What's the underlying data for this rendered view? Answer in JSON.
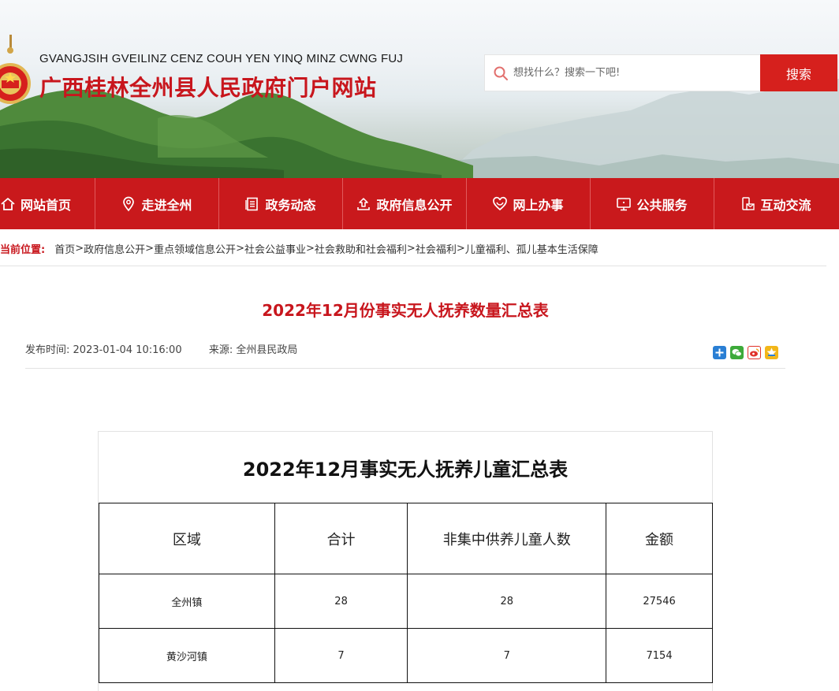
{
  "header": {
    "site_name_en": "GVANGJSIH GVEILINZ CENZ COUH YEN YINQ MINZ CWNG FUJ",
    "site_name_cn": "广西桂林全州县人民政府门户网站"
  },
  "search": {
    "placeholder": "想找什么？搜索一下吧!",
    "button_label": "搜索"
  },
  "nav": {
    "items": [
      {
        "label": "网站首页",
        "icon": "home-icon"
      },
      {
        "label": "走进全州",
        "icon": "location-pin-icon"
      },
      {
        "label": "政务动态",
        "icon": "document-icon"
      },
      {
        "label": "政府信息公开",
        "icon": "upload-icon"
      },
      {
        "label": "网上办事",
        "icon": "heart-icon"
      },
      {
        "label": "公共服务",
        "icon": "monitor-icon"
      },
      {
        "label": "互动交流",
        "icon": "mobile-mail-icon"
      }
    ]
  },
  "breadcrumb": {
    "label": "当前位置:",
    "items": [
      "首页",
      "政府信息公开",
      "重点领域信息公开",
      "社会公益事业",
      "社会救助和社会福利",
      "社会福利",
      "儿童福利、孤儿基本生活保障"
    ],
    "separator": ">"
  },
  "article": {
    "title": "2022年12月份事实无人抚养数量汇总表",
    "publish_label": "发布时间:",
    "publish_time": "2023-01-04 10:16:00",
    "source_label": "来源:",
    "source": "全州县民政局"
  },
  "share": {
    "icons": [
      "share-plus-icon",
      "wechat-icon",
      "weibo-icon",
      "qzone-icon"
    ],
    "colors": [
      "#2a7fd4",
      "#3daa3a",
      "#e0322a",
      "#f2b619"
    ]
  },
  "table": {
    "caption": "2022年12月事实无人抚养儿童汇总表",
    "headers": [
      "区域",
      "合计",
      "非集中供养儿童人数",
      "金额"
    ],
    "rows": [
      [
        "全州镇",
        "28",
        "28",
        "27546"
      ],
      [
        "黄沙河镇",
        "7",
        "7",
        "7154"
      ]
    ]
  },
  "colors": {
    "brand_red": "#c9191c",
    "search_button": "#d6201d",
    "title_red": "#c8161d"
  }
}
